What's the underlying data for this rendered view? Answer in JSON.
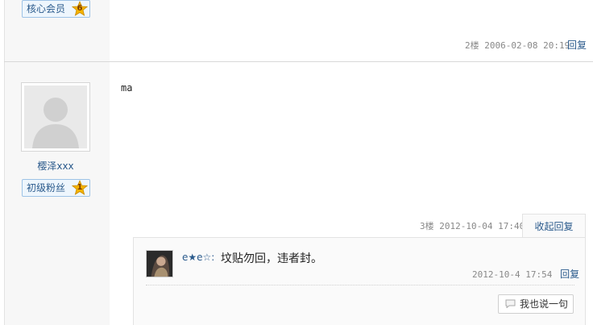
{
  "colors": {
    "link": "#2a5a8c",
    "badge_border": "#9ec3e6",
    "star": "#f5b400"
  },
  "post_prev": {
    "badge_label": "核心会员",
    "badge_level": "6",
    "floor": "2楼",
    "timestamp": "2006-02-08 20:19",
    "reply_link": "回复"
  },
  "post_current": {
    "username": "樱泽xxx",
    "badge_label": "初级粉丝",
    "badge_level": "1",
    "content": "ma",
    "floor": "3楼",
    "timestamp": "2012-10-04 17:40",
    "collapse_label": "收起回复"
  },
  "sub_reply": {
    "author": "e★e☆:",
    "text": "坟贴勿回，违者封。",
    "timestamp": "2012-10-4 17:54",
    "reply_link": "回复",
    "say_button": "我也说一句"
  }
}
